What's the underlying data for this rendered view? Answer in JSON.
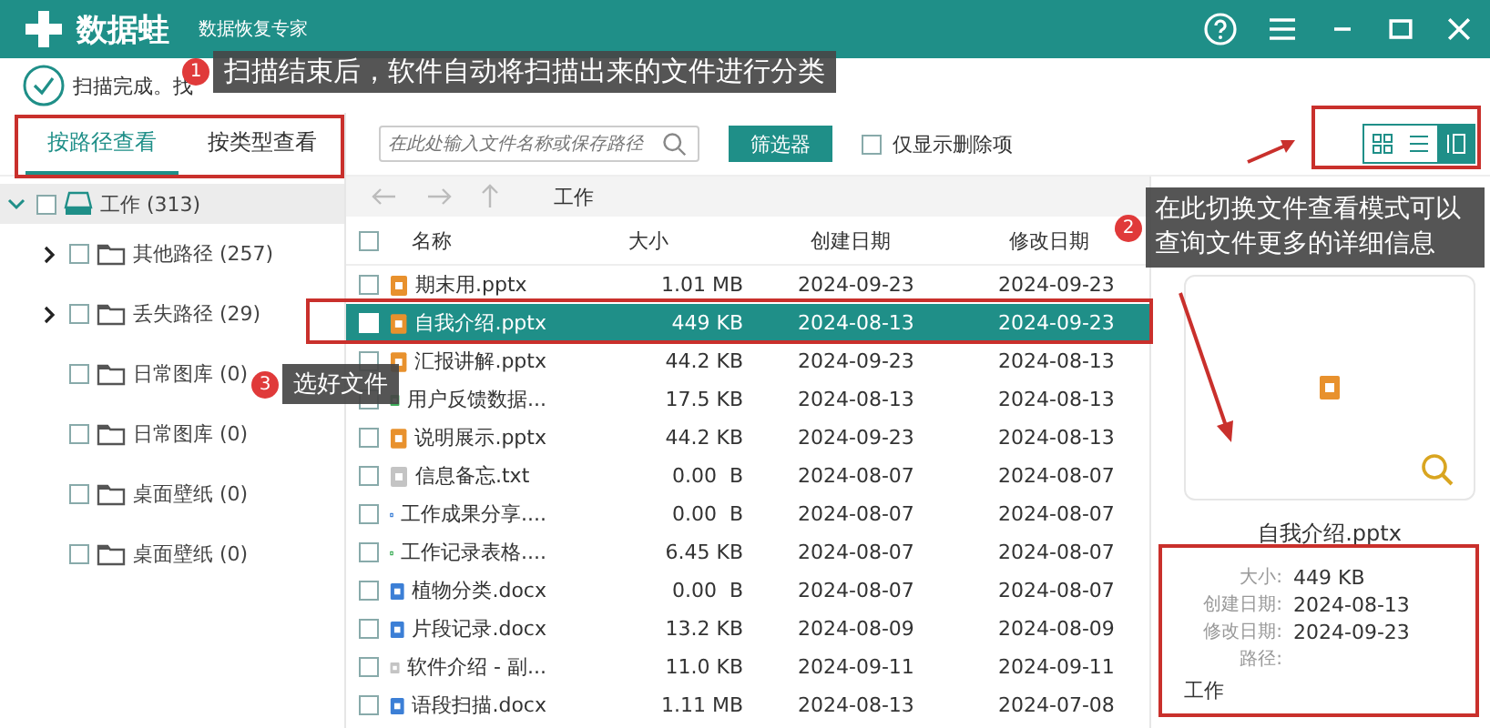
{
  "app": {
    "name": "数据蛙",
    "subtitle": "数据恢复专家"
  },
  "status_text": "扫描完成。找",
  "annotations": [
    {
      "number": "1",
      "text": "扫描结束后，软件自动将扫描出来的文件进行分类"
    },
    {
      "number": "2",
      "text": "在此切换文件查看模式可以查询文件更多的详细信息"
    },
    {
      "number": "3",
      "text": "选好文件"
    }
  ],
  "tabs": [
    {
      "label": "按路径查看",
      "selected": true
    },
    {
      "label": "按类型查看",
      "selected": false
    }
  ],
  "search": {
    "placeholder": "在此处输入文件名称或保存路径"
  },
  "filter_button": "筛选器",
  "deleted_only": {
    "label": "仅显示删除项",
    "checked": false
  },
  "view_modes": [
    {
      "kind": "grid",
      "selected": false
    },
    {
      "kind": "list",
      "selected": false
    },
    {
      "kind": "detail",
      "selected": true
    }
  ],
  "breadcrumb": "工作",
  "tree": [
    {
      "label": "工作 (313)",
      "checked": false,
      "selected": true,
      "expanded": true,
      "expandable": true,
      "children": [
        {
          "label": "其他路径 (257)",
          "checked": false,
          "selected": false,
          "expanded": false,
          "expandable": true
        },
        {
          "label": "丢失路径 (29)",
          "checked": false,
          "selected": false,
          "expanded": false,
          "expandable": true
        },
        {
          "label": "日常图库 (0)",
          "checked": false,
          "selected": false,
          "expandable": false
        },
        {
          "label": "日常图库 (0)",
          "checked": false,
          "selected": false,
          "expandable": false
        },
        {
          "label": "桌面壁纸 (0)",
          "checked": false,
          "selected": false,
          "expandable": false
        },
        {
          "label": "桌面壁纸 (0)",
          "checked": false,
          "selected": false,
          "expandable": false
        }
      ]
    }
  ],
  "table": {
    "columns": [
      "名称",
      "大小",
      "创建日期",
      "修改日期"
    ],
    "select_all": {
      "checked": false
    },
    "rows": [
      {
        "kind": "pptx",
        "name": "期末用.pptx",
        "size": "1.01 MB",
        "created": "2024-09-23",
        "modified": "2024-09-23",
        "selected": false
      },
      {
        "kind": "pptx",
        "name": "自我介绍.pptx",
        "size": "449 KB",
        "created": "2024-08-13",
        "modified": "2024-09-23",
        "selected": true
      },
      {
        "kind": "pptx",
        "name": "汇报讲解.pptx",
        "size": "44.2 KB",
        "created": "2024-09-23",
        "modified": "2024-08-13",
        "selected": false
      },
      {
        "kind": "xlsx",
        "name": "用户反馈数据...",
        "size": "17.5 KB",
        "created": "2024-08-13",
        "modified": "2024-08-13",
        "selected": false
      },
      {
        "kind": "pptx",
        "name": "说明展示.pptx",
        "size": "44.2 KB",
        "created": "2024-09-23",
        "modified": "2024-08-13",
        "selected": false
      },
      {
        "kind": "txt",
        "name": "信息备忘.txt",
        "size": "0.00  B",
        "created": "2024-08-07",
        "modified": "2024-08-07",
        "selected": false
      },
      {
        "kind": "docx",
        "name": "工作成果分享....",
        "size": "0.00  B",
        "created": "2024-08-07",
        "modified": "2024-08-07",
        "selected": false
      },
      {
        "kind": "xlsx",
        "name": "工作记录表格....",
        "size": "6.45 KB",
        "created": "2024-08-07",
        "modified": "2024-08-07",
        "selected": false
      },
      {
        "kind": "docx",
        "name": "植物分类.docx",
        "size": "0.00  B",
        "created": "2024-08-07",
        "modified": "2024-08-07",
        "selected": false
      },
      {
        "kind": "docx",
        "name": "片段记录.docx",
        "size": "13.2 KB",
        "created": "2024-08-09",
        "modified": "2024-08-09",
        "selected": false
      },
      {
        "kind": "txt",
        "name": "软件介绍 - 副...",
        "size": "11.0 KB",
        "created": "2024-09-11",
        "modified": "2024-09-11",
        "selected": false
      },
      {
        "kind": "docx",
        "name": "语段扫描.docx",
        "size": "1.11 MB",
        "created": "2024-08-13",
        "modified": "2024-07-08",
        "selected": false
      }
    ]
  },
  "preview": {
    "file_name": "自我介绍.pptx",
    "details": [
      {
        "label": "大小:",
        "value": "449 KB"
      },
      {
        "label": "创建日期:",
        "value": "2024-08-13"
      },
      {
        "label": "修改日期:",
        "value": "2024-09-23"
      },
      {
        "label": "路径:"
      }
    ],
    "path": "工作"
  }
}
